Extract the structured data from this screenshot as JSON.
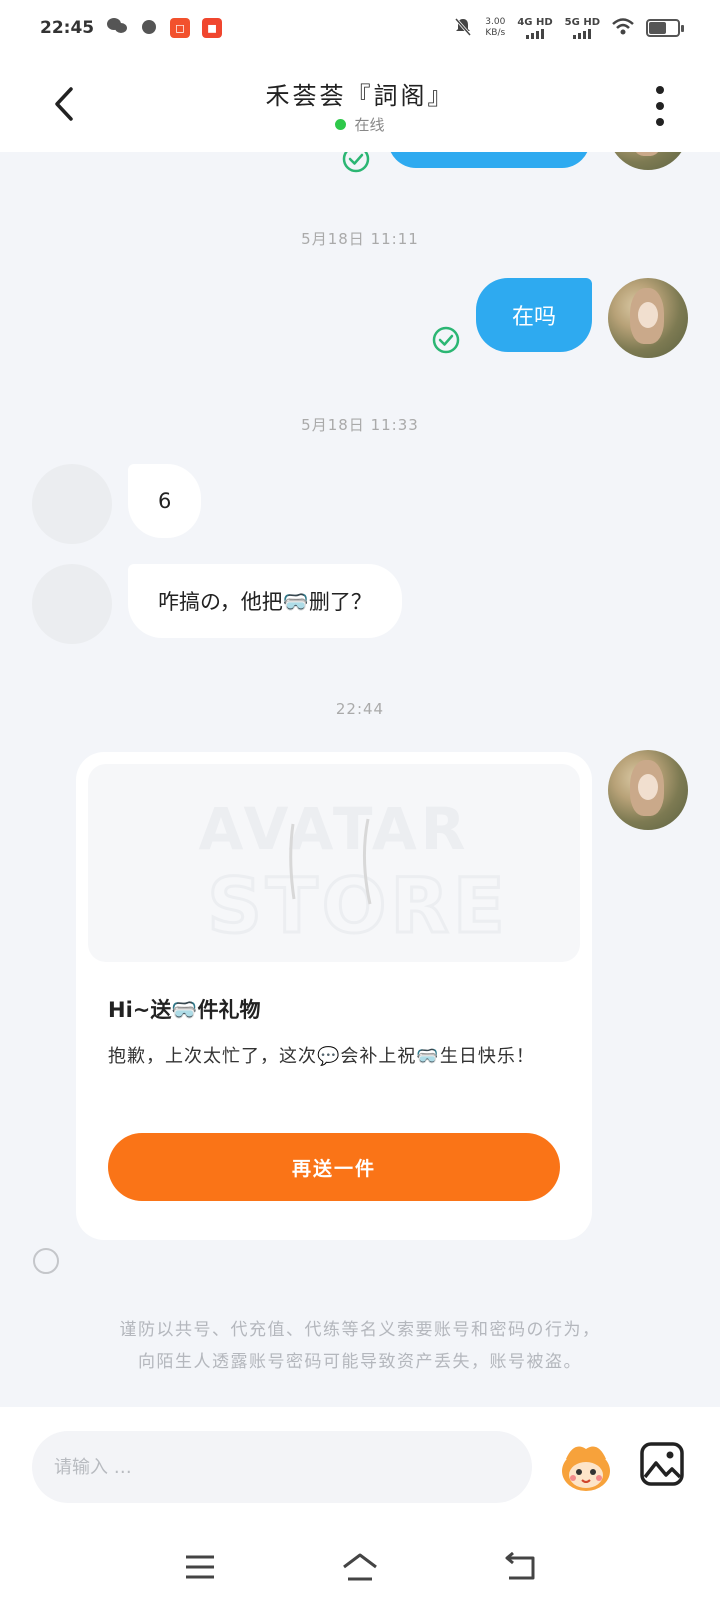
{
  "status_bar": {
    "time": "22:45",
    "net_speed_value": "3.00",
    "net_speed_unit": "KB/s",
    "sim1": "4G HD",
    "sim2": "5G HD"
  },
  "header": {
    "title": "禾荟荟『詞阁』",
    "status": "在线",
    "status_color": "#2ec84a"
  },
  "messages": {
    "ts1": "5月18日 11:11",
    "msg_sent_1": "在吗",
    "ts2": "5月18日 11:33",
    "msg_recv_1": "6",
    "msg_recv_2": "咋搞の，他把🥽删了？",
    "ts3": "22:44"
  },
  "gift_card": {
    "image_text_line1": "AVATAR",
    "image_text_line2": "STORE",
    "title": "Hi~送🥽件礼物",
    "description": "抱歉，上次太忙了，这次💬会补上祝🥽生日快乐！",
    "button_label": "再送一件",
    "button_color": "#fa7417"
  },
  "safety_notice": {
    "line1": "谨防以共号、代充值、代练等名义索要账号和密码の行为，",
    "line2": "向陌生人透露账号密码可能导致资产丢失，账号被盗。"
  },
  "input": {
    "placeholder": "请输入 …"
  },
  "colors": {
    "sent_bubble": "#2eaaf0",
    "check_green": "#2bb673",
    "background": "#f3f5f9"
  },
  "icons": [
    "back-arrow-icon",
    "more-vertical-icon",
    "check-circle-icon",
    "mascot-icon",
    "image-icon",
    "menu-icon",
    "home-icon",
    "back-icon"
  ]
}
